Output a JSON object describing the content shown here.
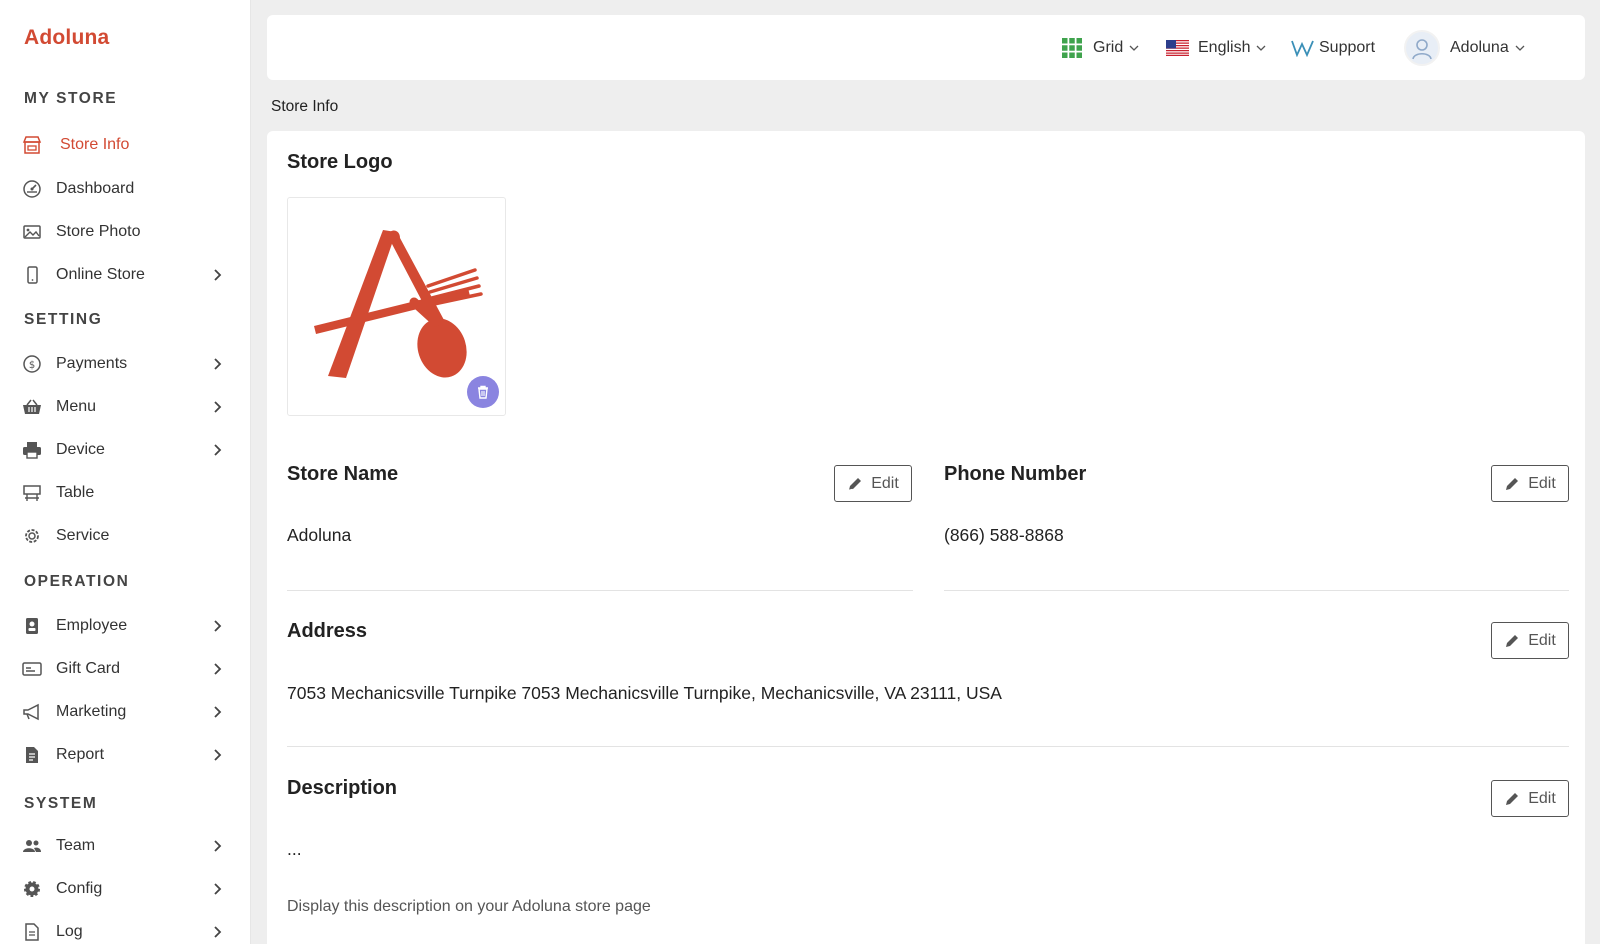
{
  "brand": "Adoluna",
  "sidebar": {
    "sections": {
      "my_store": "MY STORE",
      "setting": "SETTING",
      "operation": "OPERATION",
      "system": "SYSTEM"
    },
    "items": {
      "store_info": "Store Info",
      "dashboard": "Dashboard",
      "store_photo": "Store Photo",
      "online_store": "Online Store",
      "payments": "Payments",
      "menu": "Menu",
      "device": "Device",
      "table": "Table",
      "service": "Service",
      "employee": "Employee",
      "gift_card": "Gift Card",
      "marketing": "Marketing",
      "report": "Report",
      "team": "Team",
      "config": "Config",
      "log": "Log"
    },
    "active_item": "store_info",
    "active_color": "#d24a33"
  },
  "topbar": {
    "grid_label": "Grid",
    "language_label": "English",
    "support_label": "Support",
    "user_label": "Adoluna"
  },
  "breadcrumb": "Store Info",
  "content": {
    "store_logo_heading": "Store Logo",
    "store_name_heading": "Store Name",
    "store_name_value": "Adoluna",
    "phone_heading": "Phone Number",
    "phone_value": "(866) 588-8868",
    "address_heading": "Address",
    "address_value": "7053 Mechanicsville Turnpike 7053 Mechanicsville Turnpike, Mechanicsville, VA 23111, USA",
    "description_heading": "Description",
    "description_value": "...",
    "description_hint": "Display this description on your Adoluna store page",
    "edit_label": "Edit"
  },
  "icons": {
    "trash": "trash-icon",
    "edit": "pencil-icon",
    "grid": "grid-icon",
    "flag": "us-flag-icon",
    "support": "w-logo-icon",
    "user": "user-avatar-icon"
  },
  "colors": {
    "brand": "#d24a33",
    "trash_button": "#8a84e0",
    "grid_green": "#3fa34d"
  }
}
